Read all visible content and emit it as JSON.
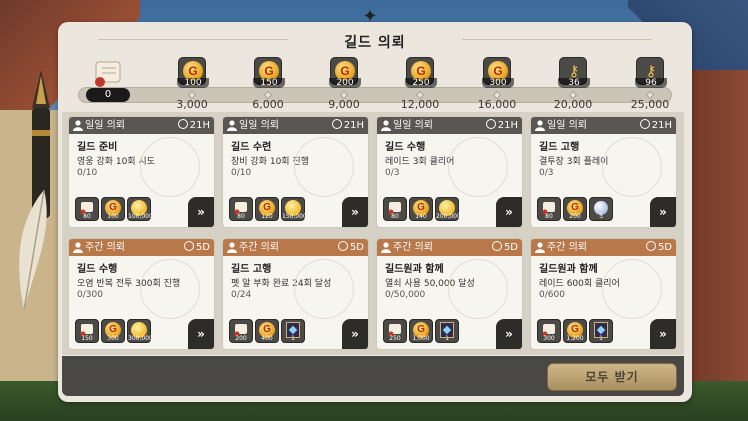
{
  "panel": {
    "title": "길드 의뢰"
  },
  "progress": {
    "current": "0",
    "fraction": 0,
    "milestones": [
      {
        "label": "3,000",
        "reward_type": "gold",
        "reward_count": "100"
      },
      {
        "label": "6,000",
        "reward_type": "gold",
        "reward_count": "150"
      },
      {
        "label": "9,000",
        "reward_type": "gold",
        "reward_count": "200"
      },
      {
        "label": "12,000",
        "reward_type": "gold",
        "reward_count": "250"
      },
      {
        "label": "16,000",
        "reward_type": "gold",
        "reward_count": "300"
      },
      {
        "label": "20,000",
        "reward_type": "key",
        "reward_count": "36"
      },
      {
        "label": "25,000",
        "reward_type": "key",
        "reward_count": "96"
      }
    ]
  },
  "quests": [
    {
      "category": "일일 의뢰",
      "timer": "21H",
      "name": "길드 준비",
      "desc": "영웅 강화 10회 시도",
      "progress": "0/10",
      "rewards": [
        "scroll",
        "gold",
        "coin"
      ],
      "reward_amounts": [
        "80",
        "100",
        "100,000"
      ]
    },
    {
      "category": "일일 의뢰",
      "timer": "21H",
      "name": "길드 수련",
      "desc": "장비 강화 10회 진행",
      "progress": "0/10",
      "rewards": [
        "scroll",
        "gold",
        "coin"
      ],
      "reward_amounts": [
        "80",
        "120",
        "150,000"
      ]
    },
    {
      "category": "일일 의뢰",
      "timer": "21H",
      "name": "길드 수행",
      "desc": "레이드 3회 클리어",
      "progress": "0/3",
      "rewards": [
        "scroll",
        "gold",
        "coin"
      ],
      "reward_amounts": [
        "80",
        "140",
        "200,000"
      ]
    },
    {
      "category": "일일 의뢰",
      "timer": "21H",
      "name": "길드 고행",
      "desc": "결투장 3회 플레이",
      "progress": "0/3",
      "rewards": [
        "scroll",
        "gold",
        "gem"
      ],
      "reward_amounts": [
        "80",
        "200",
        "3"
      ]
    },
    {
      "category": "주간 의뢰",
      "timer": "5D",
      "name": "길드 수행",
      "desc": "오염 반복 전투 300회 진행",
      "progress": "0/300",
      "rewards": [
        "scroll",
        "gold",
        "coin"
      ],
      "reward_amounts": [
        "150",
        "300",
        "300,000"
      ]
    },
    {
      "category": "주간 의뢰",
      "timer": "5D",
      "name": "길드 고행",
      "desc": "펫 알 부화 완료 24회 달성",
      "progress": "0/24",
      "rewards": [
        "scroll",
        "gold",
        "book"
      ],
      "reward_amounts": [
        "200",
        "400",
        "1"
      ]
    },
    {
      "category": "주간 의뢰",
      "timer": "5D",
      "name": "길드원과 함께",
      "desc": "열쇠 사용 50,000 달성",
      "progress": "0/50,000",
      "rewards": [
        "scroll",
        "gold",
        "book"
      ],
      "reward_amounts": [
        "250",
        "1,000",
        "1"
      ]
    },
    {
      "category": "주간 의뢰",
      "timer": "5D",
      "name": "길드원과 함께",
      "desc": "레이드 600회 클리어",
      "progress": "0/600",
      "rewards": [
        "scroll",
        "gold",
        "book"
      ],
      "reward_amounts": [
        "300",
        "1,200",
        "1"
      ]
    }
  ],
  "claim_all_label": "모두 받기"
}
